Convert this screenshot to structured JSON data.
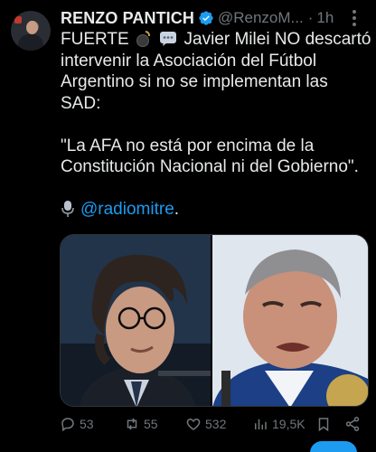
{
  "tweet": {
    "author_name": "RENZO PANTICH",
    "handle": "@RenzoM...",
    "separator": "·",
    "time": "1h",
    "lines": [
      {
        "pre": "FUERTE",
        "post": "Javier Milei NO descartó"
      },
      "intervenir la Asociación del Fútbol",
      "Argentino si no se implementan las",
      "SAD:"
    ],
    "quote_lines": [
      "\"La AFA no está por encima de la",
      "Constitución Nacional ni del Gobierno\"."
    ],
    "link_text": "@radiomitre",
    "link_suffix": "."
  },
  "actions": {
    "replies": "53",
    "retweets": "55",
    "likes": "532",
    "views": "19,5K"
  },
  "colors": {
    "background": "#000000",
    "text": "#e7e9ea",
    "muted": "#71767b",
    "accent": "#1d9bf0"
  },
  "icons": [
    "verified-badge-icon",
    "bomb-emoji-icon",
    "speech-bubble-emoji-icon",
    "microphone-emoji-icon",
    "more-options-icon",
    "reply-icon",
    "retweet-icon",
    "like-icon",
    "views-icon",
    "bookmark-icon",
    "share-icon"
  ]
}
